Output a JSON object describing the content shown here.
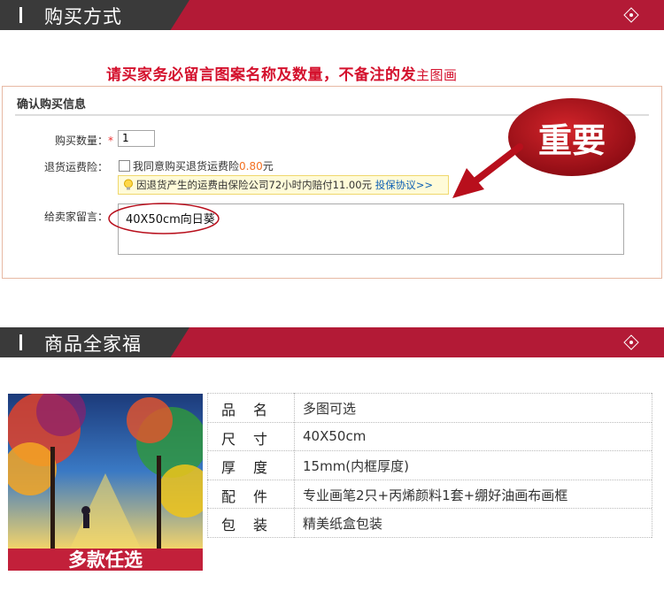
{
  "section1": {
    "title": "购买方式"
  },
  "notice": {
    "text": "请买家务必留言图案名称及数量，不备注的发",
    "extra": "主图画"
  },
  "form": {
    "panel_title": "确认购买信息",
    "quantity_label": "购买数量：",
    "required_mark": "*",
    "quantity_value": "1",
    "return_label": "退货运费险：",
    "return_checkbox_text": "我同意购买退货运费险",
    "return_price": "0.80",
    "return_unit": "元",
    "tip_text": "因退货产生的运费由保险公司72小时内赔付11.00元",
    "tip_link": "投保协议>>",
    "message_label": "给卖家留言：",
    "message_value": "40X50cm向日葵"
  },
  "callout": {
    "text": "重要"
  },
  "section2": {
    "title": "商品全家福"
  },
  "product": {
    "photo_caption": "多款任选",
    "rows": [
      {
        "key": "品名",
        "value": "多图可选"
      },
      {
        "key": "尺寸",
        "value": "40X50cm"
      },
      {
        "key": "厚度",
        "value": "15mm(内框厚度)"
      },
      {
        "key": "配件",
        "value": "专业画笔2只+丙烯颜料1套+绷好油画布画框"
      },
      {
        "key": "包装",
        "value": "精美纸盒包装"
      }
    ]
  },
  "colors": {
    "brand": "#b31a36",
    "dark": "#3a3a3a",
    "accent": "#d4112d",
    "callout": "#b80f1c"
  }
}
